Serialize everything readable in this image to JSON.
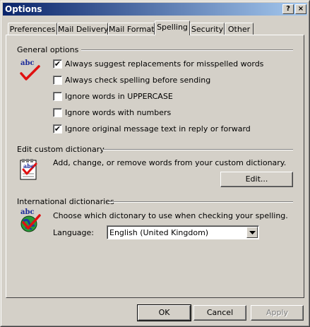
{
  "window": {
    "title": "Options",
    "help_glyph": "?",
    "close_glyph": "×"
  },
  "tabs": [
    {
      "label": "Preferences",
      "active": false
    },
    {
      "label": "Mail Delivery",
      "active": false
    },
    {
      "label": "Mail Format",
      "active": false
    },
    {
      "label": "Spelling",
      "active": true
    },
    {
      "label": "Security",
      "active": false
    },
    {
      "label": "Other",
      "active": false
    }
  ],
  "general": {
    "title": "General options",
    "icon": "abc-spell-check-icon",
    "icon_text": "abc",
    "options": [
      {
        "label": "Always suggest replacements for misspelled words",
        "checked": true
      },
      {
        "label": "Always check spelling before sending",
        "checked": false
      },
      {
        "label": "Ignore words in UPPERCASE",
        "checked": false
      },
      {
        "label": "Ignore words with numbers",
        "checked": false
      },
      {
        "label": "Ignore original message text in reply or forward",
        "checked": true
      }
    ],
    "check_glyph": "✔"
  },
  "custom_dictionary": {
    "title": "Edit custom dictionary",
    "icon": "dictionary-notepad-icon",
    "icon_text": "abc",
    "description": "Add, change, or remove words from your custom dictionary.",
    "edit_label": "Edit..."
  },
  "international": {
    "title": "International dictionaries",
    "icon": "globe-spell-check-icon",
    "icon_text": "abc",
    "description": "Choose which dictonary to use when checking your spelling.",
    "language_label": "Language:",
    "language_value": "English (United Kingdom)"
  },
  "footer": {
    "ok_label": "OK",
    "cancel_label": "Cancel",
    "apply_label": "Apply",
    "apply_enabled": false
  },
  "colors": {
    "face": "#d4d0c8",
    "title_start": "#0a246a",
    "title_end": "#a6caf0",
    "check_red": "#e01010",
    "abc_blue": "#1a2a9a"
  }
}
